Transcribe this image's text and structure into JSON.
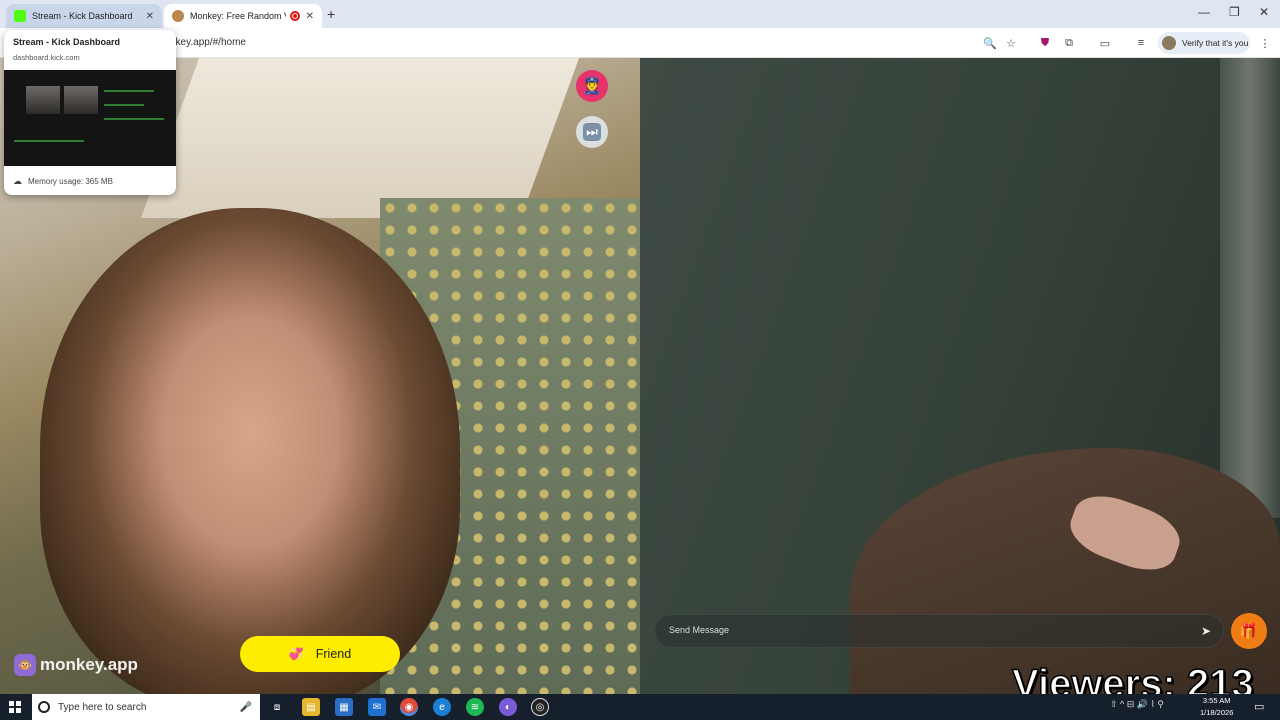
{
  "browser": {
    "tabs": [
      {
        "title": "Stream - Kick Dashboard",
        "active": false
      },
      {
        "title": "Monkey: Free Random Vide",
        "active": true
      }
    ],
    "new_tab": "+",
    "url": "nkey.app/#/home",
    "window_controls": {
      "minimize": "—",
      "restore": "❐",
      "close": "✕"
    },
    "verify_label": "Verify that it's you"
  },
  "tab_preview": {
    "title": "Stream - Kick Dashboard",
    "url": "dashboard.kick.com",
    "memory": "Memory usage: 365 MB"
  },
  "overlay": {
    "friend_label": "Friend",
    "logo_text": "monkey.app",
    "message_placeholder": "Send Message",
    "viewers": "Viewers: 213"
  },
  "taskbar": {
    "search_placeholder": "Type here to search",
    "date": "1/18/2026",
    "time": "3:55 AM"
  },
  "colors": {
    "friend_button": "#ffed00",
    "police_button": "#e8326a",
    "gift_button": "#f07d13",
    "kick_green": "#53fc18",
    "monkey_purple": "#8e6bd6"
  }
}
